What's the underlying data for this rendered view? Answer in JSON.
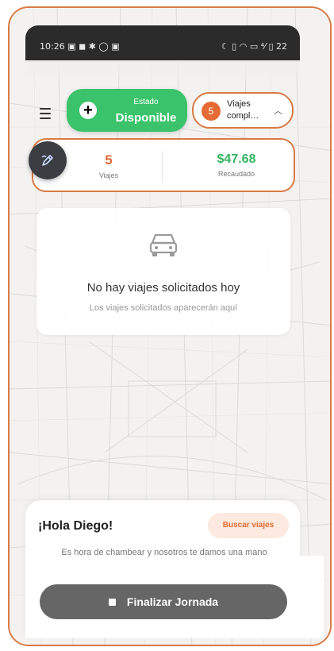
{
  "status_bar": {
    "left": "10:26 ▣ ◼ ✱ ◯ ▣",
    "right": "☾ ▯ ◠ ▭ ⁴⁄ ▯ 22"
  },
  "header": {
    "menu_icon": "hamburger-icon"
  },
  "estado": {
    "label": "Estado",
    "value": "Disponible",
    "icon": "plus-icon"
  },
  "viajes_pill": {
    "count": "5",
    "line1": "Viajes",
    "line2": "compl…",
    "chevron": "chevron-up-icon"
  },
  "stats": {
    "trips_value": "5",
    "trips_label": "Viajes",
    "collected_value": "$47.68",
    "collected_label": "Recaudado",
    "edit_icon": "edit-icon"
  },
  "empty_state": {
    "icon": "car-icon",
    "title": "No hay viajes solicitados hoy",
    "description": "Los viajes solicitados aparecerán aquí"
  },
  "sheet": {
    "greeting": "¡Hola Diego!",
    "search_button": "Buscar viajes",
    "message": "Es hora de chambear y nosotros te damos una mano",
    "finish_button": "Finalizar Jornada"
  },
  "colors": {
    "accent": "#d97a45",
    "available": "#3ac36a",
    "money": "#33b560",
    "dark": "#3a3d42"
  }
}
